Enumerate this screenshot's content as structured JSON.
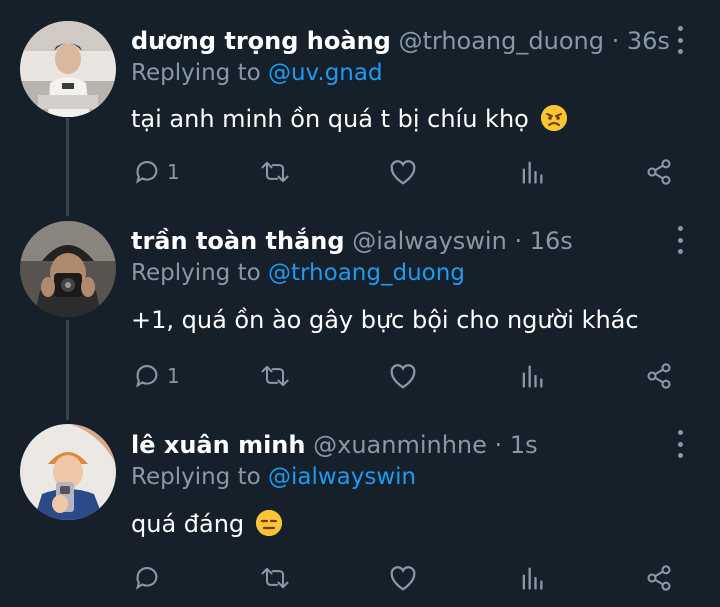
{
  "tweets": [
    {
      "name": "dương trọng hoàng",
      "handle": "@trhoang_duong",
      "separator": "·",
      "time": "36s",
      "reply_prefix": "Replying to",
      "reply_to": "@uv.gnad",
      "text": "tại anh minh ồn quá t bị chíu khọ",
      "emoji": "angry-face",
      "reply_count": "1"
    },
    {
      "name": "trần toàn thắng",
      "handle": "@ialwayswin",
      "separator": "·",
      "time": "16s",
      "reply_prefix": "Replying to",
      "reply_to": "@trhoang_duong",
      "text": "+1, quá ồn ào gây bực bội cho người khác",
      "reply_count": "1"
    },
    {
      "name": "lê xuân minh",
      "handle": "@xuanminhne",
      "separator": "·",
      "time": "1s",
      "reply_prefix": "Replying to",
      "reply_to": "@ialwayswin",
      "text": "quá đáng",
      "emoji": "expressionless-face",
      "reply_count": ""
    }
  ],
  "colors": {
    "background": "#15202b",
    "secondary_text": "#8899a6",
    "mention": "#1d9bf0",
    "thread_line": "#38444d"
  }
}
